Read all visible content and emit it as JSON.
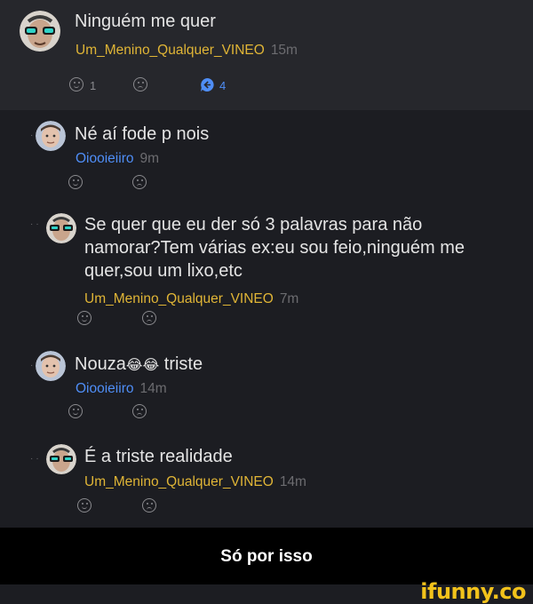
{
  "post": {
    "text": "Ninguém me quer",
    "author": "Um_Menino_Qualquer_VINEO",
    "time": "15m",
    "smile_count": "1",
    "reply_count": "4"
  },
  "replies": [
    {
      "text": "Né aí fode p nois",
      "author": "Oiooieiiro",
      "time": "9m"
    },
    {
      "text_lines": [
        "Se quer que eu der só 3 palavras para não",
        "namorar?Tem várias ex:eu sou feio,ninguém me",
        "quer,sou um lixo,etc"
      ],
      "author": "Um_Menino_Qualquer_VINEO",
      "time": "7m"
    },
    {
      "text_before": "Nouza",
      "emoji": "😂😂",
      "text_after": " triste",
      "author": "Oiooieiiro",
      "time": "14m"
    },
    {
      "text": "É a triste realidade",
      "author": "Um_Menino_Qualquer_VINEO",
      "time": "14m"
    }
  ],
  "caption": "Só por isso",
  "watermark": "ifunny.co",
  "colors": {
    "bg": "#1c1d22",
    "post_bg": "#26272c",
    "author_yellow": "#e0b536",
    "author_blue": "#4f8ef7",
    "time_gray": "#6c6c70",
    "watermark": "#f2c21b"
  },
  "icons": [
    "smile-icon",
    "sad-icon",
    "reply-bubble-icon"
  ]
}
